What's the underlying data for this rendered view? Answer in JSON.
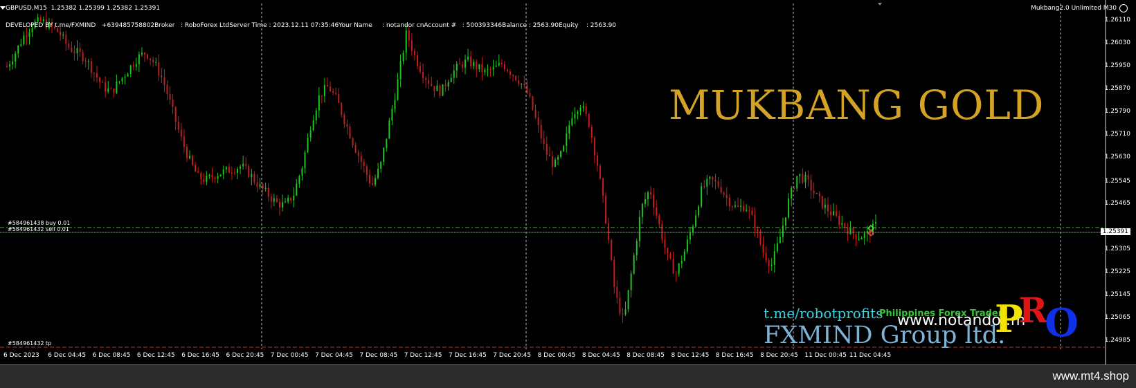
{
  "header": {
    "symbol_info": "GBPUSD,M15  1.25382 1.25399 1.25382 1.25391",
    "info_line": "DEVELOPED BY t.me/FXMIND   +639485758802Broker   : RoboForex LtdServer Time : 2023.12.11 07:35:46Your Name     : notandor cnAccount #   : 500393346Balance : 2563.90Equity    : 2563.90",
    "indicator": "Mukbang2.0 Unlimited M30"
  },
  "orders": {
    "buy": "#584961438 buy 0.01",
    "sell": "#584961432 sell 0.01",
    "tp": "#584961432 tp"
  },
  "price_axis": [
    "1.26110",
    "1.26030",
    "1.25950",
    "1.25870",
    "1.25790",
    "1.25710",
    "1.25630",
    "1.25545",
    "1.25465",
    "1.25305",
    "1.25225",
    "1.25145",
    "1.25065",
    "1.24985"
  ],
  "current_price": "1.25391",
  "time_axis": [
    "6 Dec 2023",
    "6 Dec 04:45",
    "6 Dec 08:45",
    "6 Dec 12:45",
    "6 Dec 16:45",
    "6 Dec 20:45",
    "7 Dec 00:45",
    "7 Dec 04:45",
    "7 Dec 08:45",
    "7 Dec 12:45",
    "7 Dec 16:45",
    "7 Dec 20:45",
    "8 Dec 00:45",
    "8 Dec 04:45",
    "8 Dec 08:45",
    "8 Dec 12:45",
    "8 Dec 16:45",
    "8 Dec 20:45",
    "11 Dec 00:45",
    "11 Dec 04:45"
  ],
  "overlay": {
    "brand_title": "MUKBANG GOLD",
    "telegram": "t.me/robotprofits",
    "ph_trader": "Philippines Forex Trader",
    "website": "www.notandor.m",
    "group_name": "FXMIND Group ltd.",
    "pro_p": "P",
    "pro_r": "R",
    "pro_o": "O"
  },
  "footer": {
    "site": "www.mt4.shop"
  },
  "colors": {
    "bull": "#22c422",
    "bear": "#c41e1e",
    "grid": "#ffffff",
    "brand": "#d4a225"
  },
  "chart_data": {
    "type": "candlestick",
    "symbol": "GBPUSD",
    "timeframe": "M15",
    "ylim": [
      1.24955,
      1.2614
    ],
    "close_path": [
      1.2595,
      1.26,
      1.2606,
      1.261,
      1.2611,
      1.2609,
      1.2607,
      1.2602,
      1.26,
      1.2598,
      1.2593,
      1.2588,
      1.2586,
      1.259,
      1.2594,
      1.2598,
      1.26,
      1.2596,
      1.259,
      1.258,
      1.257,
      1.2562,
      1.2556,
      1.2555,
      1.2557,
      1.2558,
      1.2559,
      1.256,
      1.2557,
      1.2553,
      1.255,
      1.2547,
      1.2546,
      1.255,
      1.256,
      1.2575,
      1.2585,
      1.2588,
      1.2583,
      1.2575,
      1.2567,
      1.256,
      1.2553,
      1.256,
      1.2575,
      1.259,
      1.2607,
      1.2598,
      1.2592,
      1.2588,
      1.2586,
      1.2592,
      1.2595,
      1.2597,
      1.2595,
      1.2593,
      1.2594,
      1.2596,
      1.2593,
      1.259,
      1.2585,
      1.2575,
      1.2565,
      1.256,
      1.2565,
      1.2578,
      1.2582,
      1.2575,
      1.256,
      1.254,
      1.2515,
      1.2505,
      1.2525,
      1.2545,
      1.2552,
      1.254,
      1.2528,
      1.2522,
      1.253,
      1.254,
      1.2552,
      1.2555,
      1.2553,
      1.2548,
      1.2545,
      1.2546,
      1.254,
      1.253,
      1.2525,
      1.2535,
      1.2548,
      1.2557,
      1.2555,
      1.255,
      1.2546,
      1.2543,
      1.254,
      1.2537,
      1.2535,
      1.2536,
      1.2539
    ]
  }
}
